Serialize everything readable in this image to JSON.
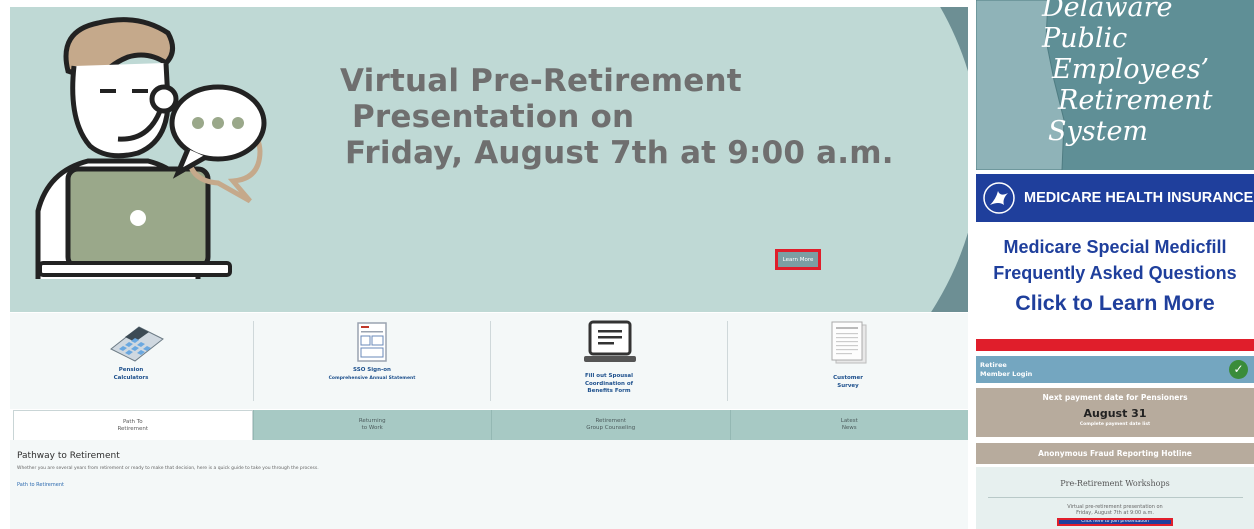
{
  "hero": {
    "title_line1": "Virtual Pre-Retirement",
    "title_line2": "Presentation on",
    "title_line3": "Friday, August 7th at 9:00 a.m.",
    "button_label": "Learn More"
  },
  "quicklinks": [
    {
      "label": "Pension",
      "label2": "Calculators",
      "sub": "",
      "icon": "calculator-icon"
    },
    {
      "label": "SSO Sign-on",
      "label2": "",
      "sub": "Comprehensive Annual Statement",
      "icon": "document-form-icon"
    },
    {
      "label": "Fill out Spousal",
      "label2": "Coordination of",
      "label3": "Benefits Form",
      "icon": "laptop-icon"
    },
    {
      "label": "Customer",
      "label2": "Survey",
      "sub": "",
      "icon": "survey-form-icon"
    }
  ],
  "tabs": [
    {
      "line1": "Path To",
      "line2": "Retirement"
    },
    {
      "line1": "Returning",
      "line2": "to Work"
    },
    {
      "line1": "Retirement",
      "line2": "Group Counseling"
    },
    {
      "line1": "Latest",
      "line2": "News"
    }
  ],
  "content": {
    "heading": "Pathway to Retirement",
    "description": "Whether you are several years from retirement or ready to make that decision, here is a quick guide to take you through the process.",
    "link": "Path to Retirement"
  },
  "sidebar": {
    "dperts_lines": [
      "Delaware",
      "Public",
      "Employees’",
      "Retirement",
      "System"
    ],
    "medicare_header": "MEDICARE HEALTH INSURANCE",
    "medicare_line1": "Medicare Special Medicfill",
    "medicare_line2": "Frequently Asked Questions",
    "medicare_cta": "Click to Learn More",
    "retiree_line1": "Retiree",
    "retiree_line2": "Member Login",
    "payment_heading": "Next payment date for Pensioners",
    "payment_date": "August 31",
    "payment_sub": "Complete payment date list",
    "fraud_hotline": "Anonymous Fraud Reporting Hotline",
    "workshops_heading": "Pre-Retirement Workshops",
    "workshops_text1": "Virtual pre-retirement presentation on",
    "workshops_text2": "Friday, August 7th at 9:00 a.m.",
    "workshops_button": "Click here to join presentation"
  },
  "colors": {
    "accent_red": "#e01e2b",
    "medicare_blue": "#1f3f9c",
    "teal": "#a7c9c4"
  }
}
